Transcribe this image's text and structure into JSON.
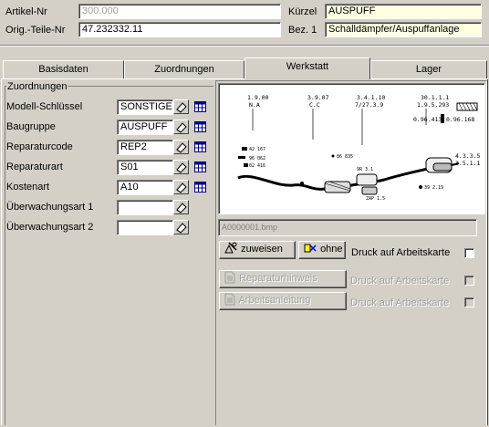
{
  "header": {
    "artikel_nr_label": "Artikel-Nr",
    "artikel_nr_value": "300.000",
    "orig_teile_nr_label": "Orig.-Teile-Nr",
    "orig_teile_nr_value": "47.232332.11",
    "kuerzel_label": "Kürzel",
    "kuerzel_value": "AUSPUFF",
    "bez1_label": "Bez. 1",
    "bez1_value": "Schalldämpfer/Auspuffanlage"
  },
  "tabs": [
    {
      "label": "Basisdaten"
    },
    {
      "label": "Zuordnungen"
    },
    {
      "label": "Werkstatt"
    },
    {
      "label": "Lager"
    }
  ],
  "active_tab": "Werkstatt",
  "zuordnungen": {
    "title": "Zuordnungen",
    "rows": [
      {
        "label": "Modell-Schlüssel",
        "value": "SONSTIGE"
      },
      {
        "label": "Baugruppe",
        "value": "AUSPUFF"
      },
      {
        "label": "Reparaturcode",
        "value": "REP2"
      },
      {
        "label": "Reparaturart",
        "value": "S01"
      },
      {
        "label": "Kostenart",
        "value": "A10"
      },
      {
        "label": "Überwachungsart 1",
        "value": ""
      },
      {
        "label": "Überwachungsart 2",
        "value": ""
      }
    ]
  },
  "image_panel": {
    "filename": "A0000001.bmp",
    "diagram_labels": [
      "1.9.00",
      "N.A",
      "3.9.07",
      "C.C",
      "3.4.1.10",
      "7/27.3.9",
      "30.1.1.1",
      "1.9.5.293",
      "0.96.413",
      "0.96.168",
      "4.3.3.5",
      "3.5.1.1"
    ]
  },
  "buttons": {
    "zuweisen": "zuweisen",
    "ohne": "ohne",
    "druck_label": "Druck auf Arbeitskarte",
    "reparaturhinweis": "Reparaturhinweis",
    "arbeitsanleitung": "Arbeitsanleitung"
  },
  "colors": {
    "window_bg": "#d4d0c8",
    "field_bg": "#ffffff",
    "highlight_field_bg": "#ffffe1",
    "disabled_text": "#a0a0a0"
  }
}
